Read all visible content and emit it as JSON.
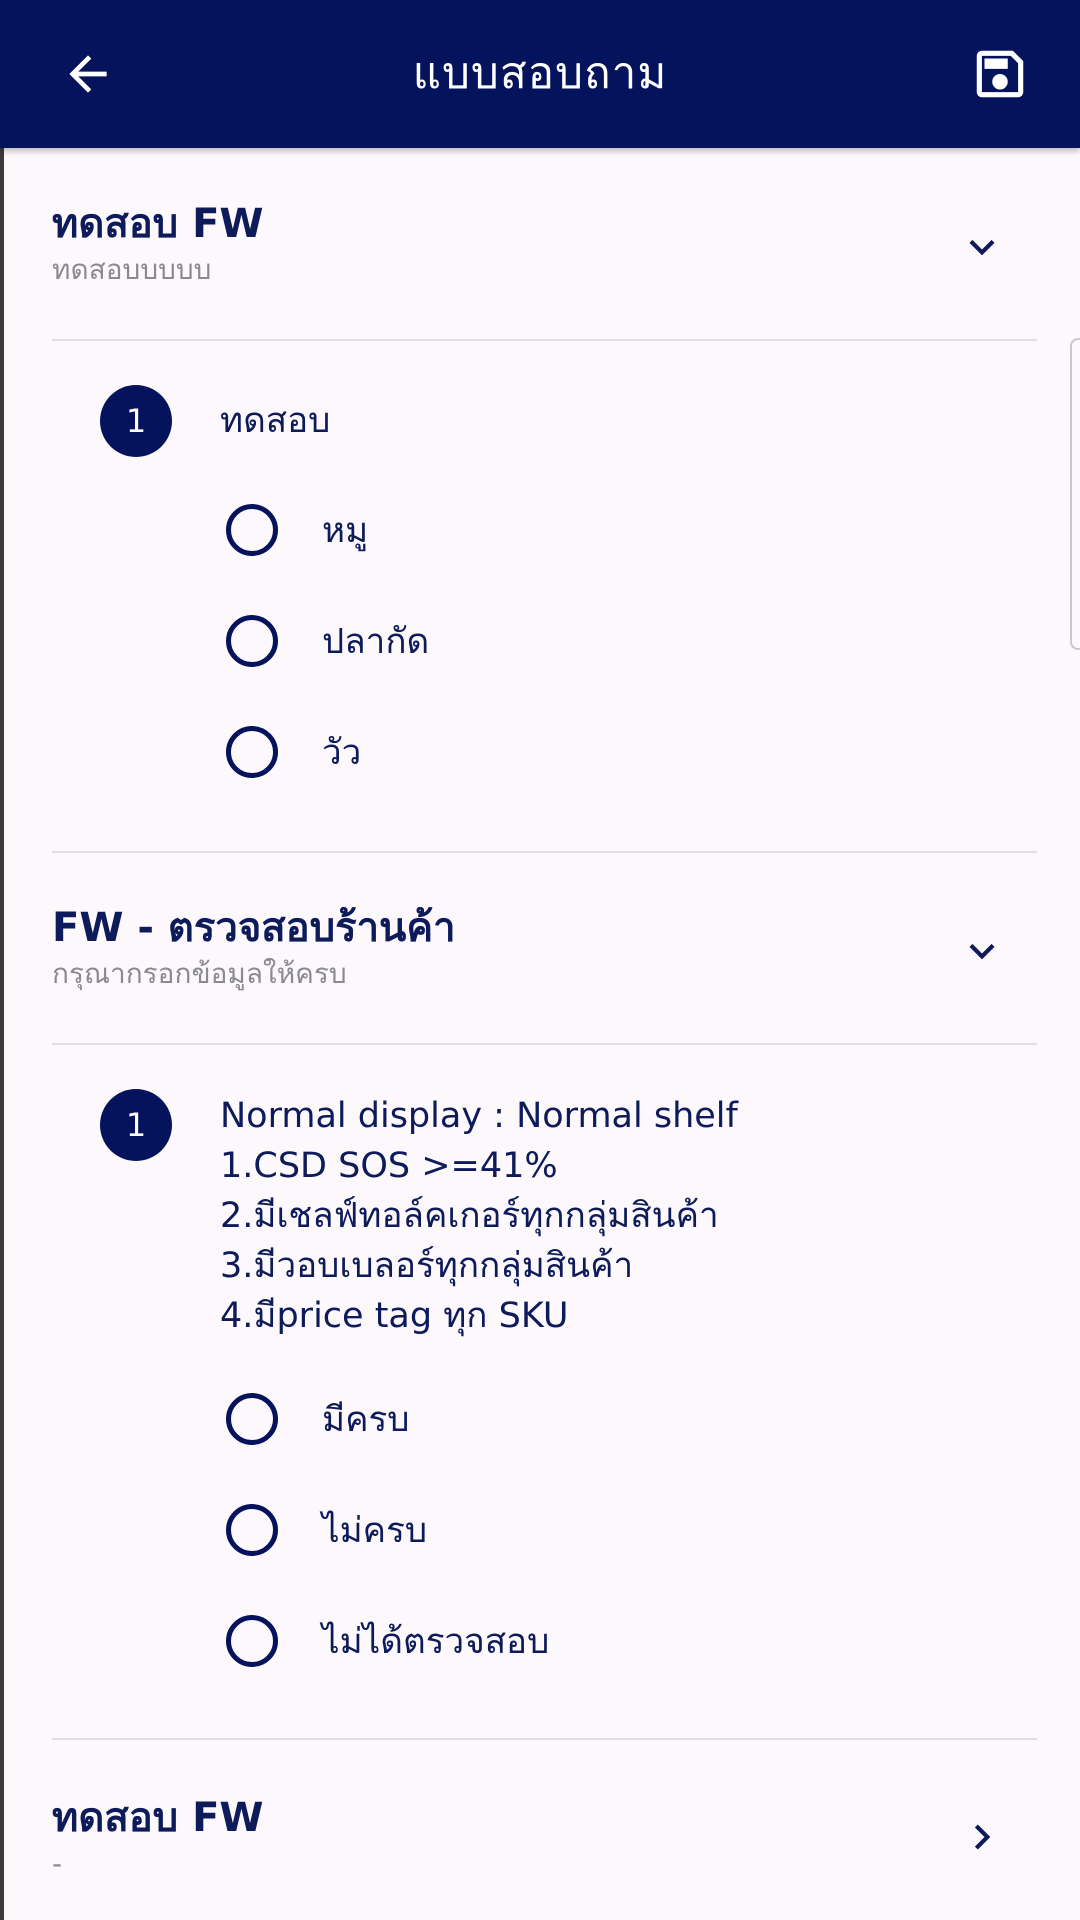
{
  "app_bar": {
    "title": "แบบสอบถาม",
    "icons": {
      "back": "arrow-left-icon",
      "save": "floppy-disk-icon"
    },
    "background": "#04135c"
  },
  "sections": [
    {
      "title": "ทดสอบ FW",
      "subtitle": "ทดสอบบบบบ",
      "expanded": true,
      "questions": [
        {
          "number": "1",
          "lines": [
            "ทดสอบ"
          ],
          "options": [
            "หมู",
            "ปลากัด",
            "วัว"
          ]
        }
      ]
    },
    {
      "title": "FW - ตรวจสอบร้านค้า",
      "subtitle": "กรุณากรอกข้อมูลให้ครบ",
      "expanded": true,
      "questions": [
        {
          "number": "1",
          "lines": [
            "Normal display : Normal shelf",
            "1.CSD SOS >=41%",
            "2.มีเชลฟ์ทอล์คเกอร์ทุกกลุ่มสินค้า",
            "3.มีวอบเบลอร์ทุกกลุ่มสินค้า",
            "4.มีprice tag ทุก SKU"
          ],
          "options": [
            "มีครบ",
            "ไม่ครบ",
            "ไม่ได้ตรวจสอบ"
          ]
        }
      ]
    },
    {
      "title": "ทดสอบ FW",
      "subtitle": "-",
      "expanded": false
    }
  ],
  "colors": {
    "primary": "#04135c",
    "text": "#0d1b5a",
    "subtitle": "#8a8a93",
    "background": "#fdf8fc",
    "divider": "#e2dde3"
  }
}
